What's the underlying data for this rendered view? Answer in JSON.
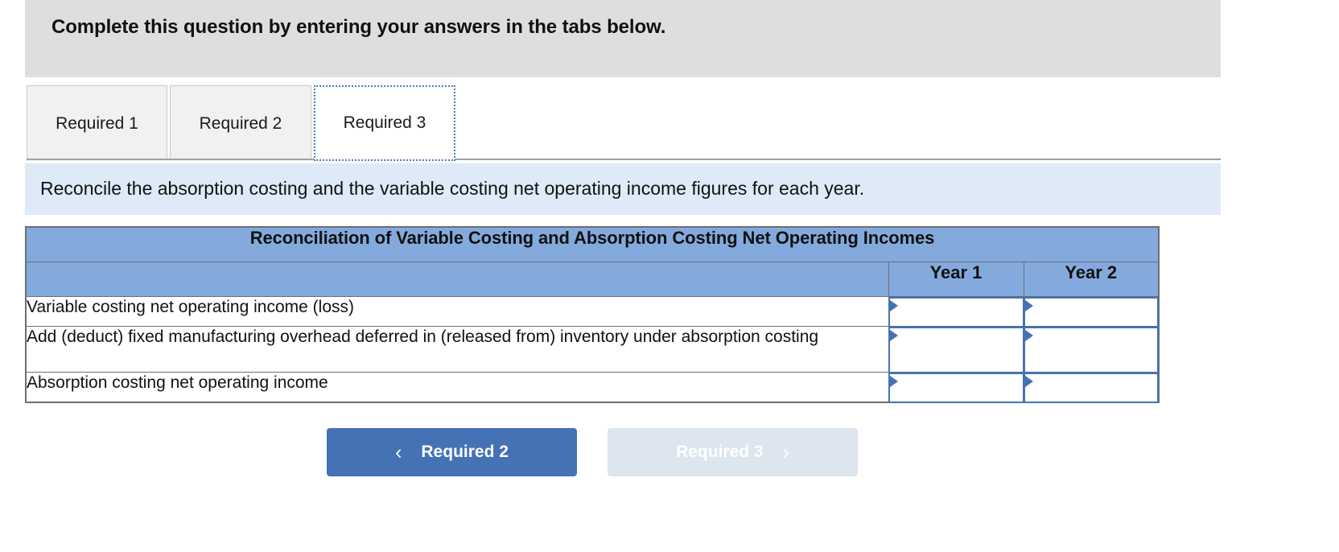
{
  "banner": {
    "text": "Complete this question by entering your answers in the tabs below."
  },
  "tabs": [
    {
      "label": "Required 1",
      "active": false
    },
    {
      "label": "Required 2",
      "active": false
    },
    {
      "label": "Required 3",
      "active": true
    }
  ],
  "prompt": {
    "text": "Reconcile the absorption costing and the variable costing net operating income figures for each year."
  },
  "table": {
    "title": "Reconciliation of Variable Costing and Absorption Costing Net Operating Incomes",
    "columns": [
      "",
      "Year 1",
      "Year 2"
    ],
    "rows": [
      {
        "label": "Variable costing net operating income (loss)",
        "year1": "",
        "year2": ""
      },
      {
        "label": "Add (deduct) fixed manufacturing overhead deferred in (released from) inventory under absorption costing",
        "year1": "",
        "year2": ""
      },
      {
        "label": "Absorption costing net operating income",
        "year1": "",
        "year2": ""
      }
    ]
  },
  "footer": {
    "prev_label": "Required 2",
    "prev_icon": "chevron-left-icon",
    "prev_glyph": "‹",
    "next_label": "Required 3",
    "next_icon": "chevron-right-icon",
    "next_glyph": "›"
  },
  "colors": {
    "banner_gray": "#dedede",
    "prompt_blue": "#deeaf7",
    "header_blue": "#84aadd",
    "accent_blue": "#4472b5",
    "disabled_blue": "#dde5ef",
    "border_gray": "#6e6e6e"
  }
}
